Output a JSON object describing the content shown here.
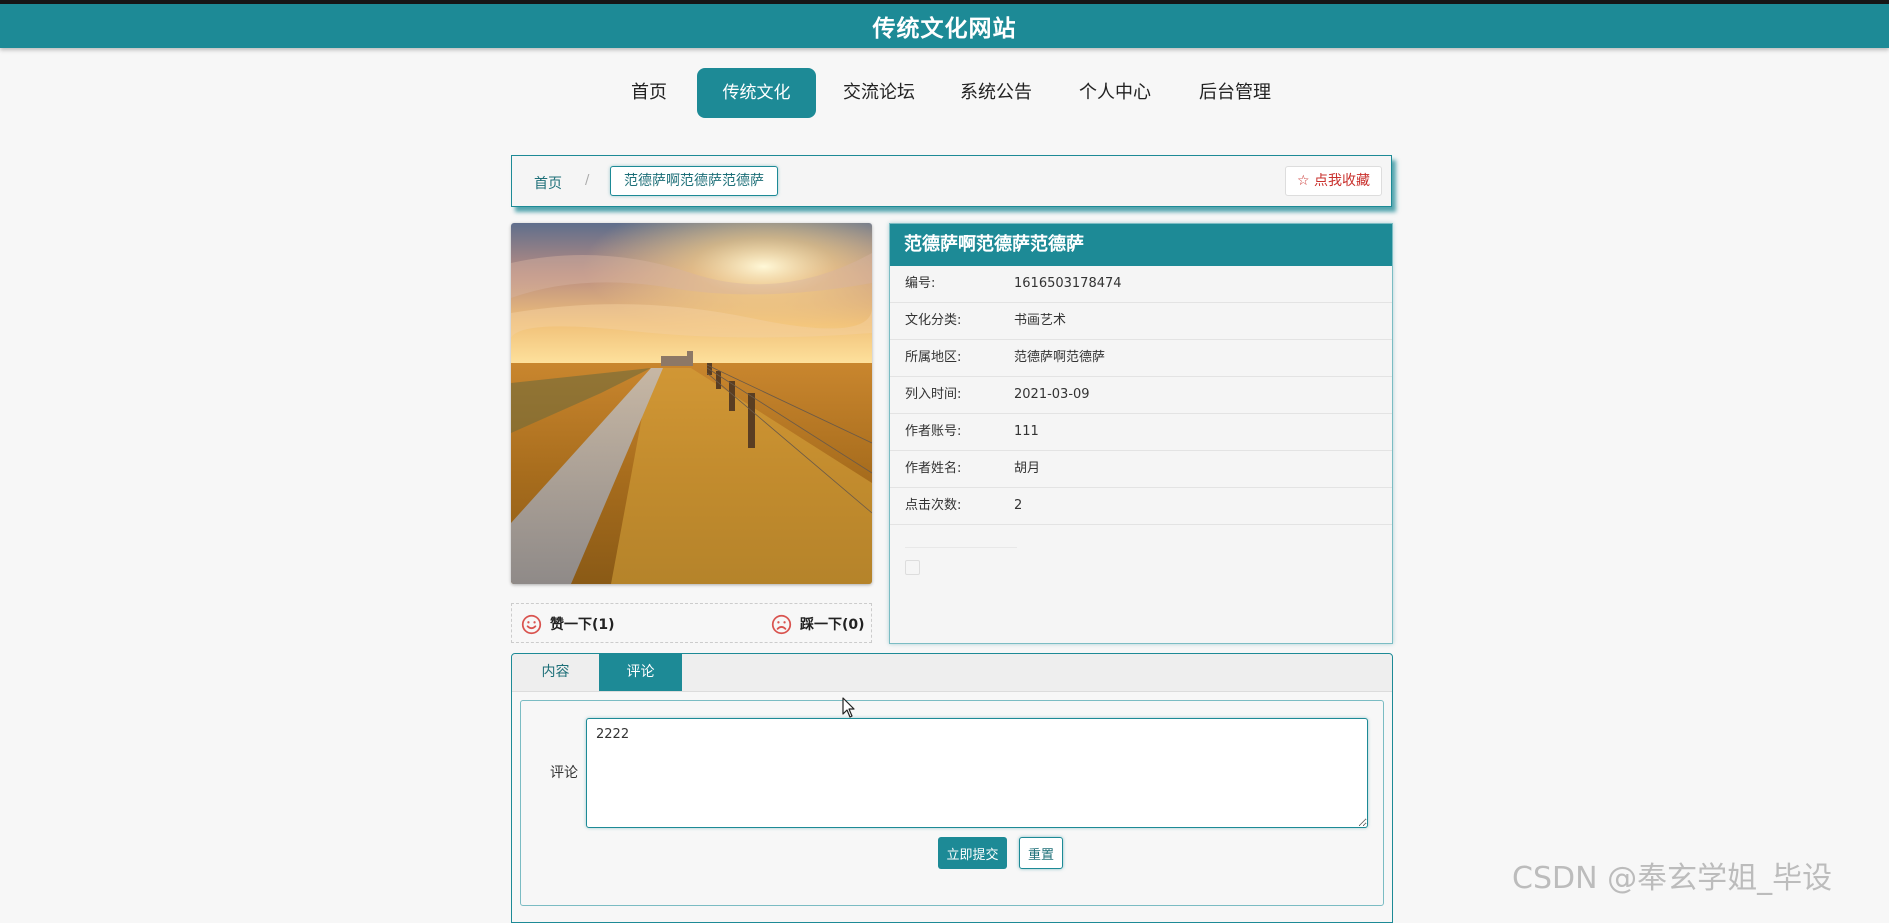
{
  "site": {
    "title": "传统文化网站"
  },
  "nav": {
    "items": [
      {
        "label": "首页"
      },
      {
        "label": "传统文化"
      },
      {
        "label": "交流论坛"
      },
      {
        "label": "系统公告"
      },
      {
        "label": "个人中心"
      },
      {
        "label": "后台管理"
      }
    ],
    "active_index": 1
  },
  "breadcrumb": {
    "home": "首页",
    "separator": "/",
    "current": "范德萨啊范德萨范德萨"
  },
  "favorite": {
    "icon": "star-outline-icon",
    "label": "点我收藏"
  },
  "votes": {
    "like": {
      "icon": "smile-icon",
      "label": "赞一下(1)"
    },
    "dislike": {
      "icon": "frown-icon",
      "label": "踩一下(0)"
    }
  },
  "detail": {
    "title": "范德萨啊范德萨范德萨",
    "rows": [
      {
        "label": "编号:",
        "value": "1616503178474"
      },
      {
        "label": "文化分类:",
        "value": "书画艺术"
      },
      {
        "label": "所属地区:",
        "value": "范德萨啊范德萨"
      },
      {
        "label": "列入时间:",
        "value": "2021-03-09"
      },
      {
        "label": "作者账号:",
        "value": "111"
      },
      {
        "label": "作者姓名:",
        "value": "胡月"
      },
      {
        "label": "点击次数:",
        "value": "2"
      }
    ]
  },
  "tabs": {
    "items": [
      {
        "label": "内容"
      },
      {
        "label": "评论"
      }
    ],
    "active_index": 1
  },
  "comment_form": {
    "label": "评论",
    "value": "2222",
    "submit_label": "立即提交",
    "reset_label": "重置"
  },
  "watermark": "CSDN @奉玄学姐_毕设",
  "colors": {
    "primary": "#1d8a96",
    "danger": "#c9302c"
  }
}
